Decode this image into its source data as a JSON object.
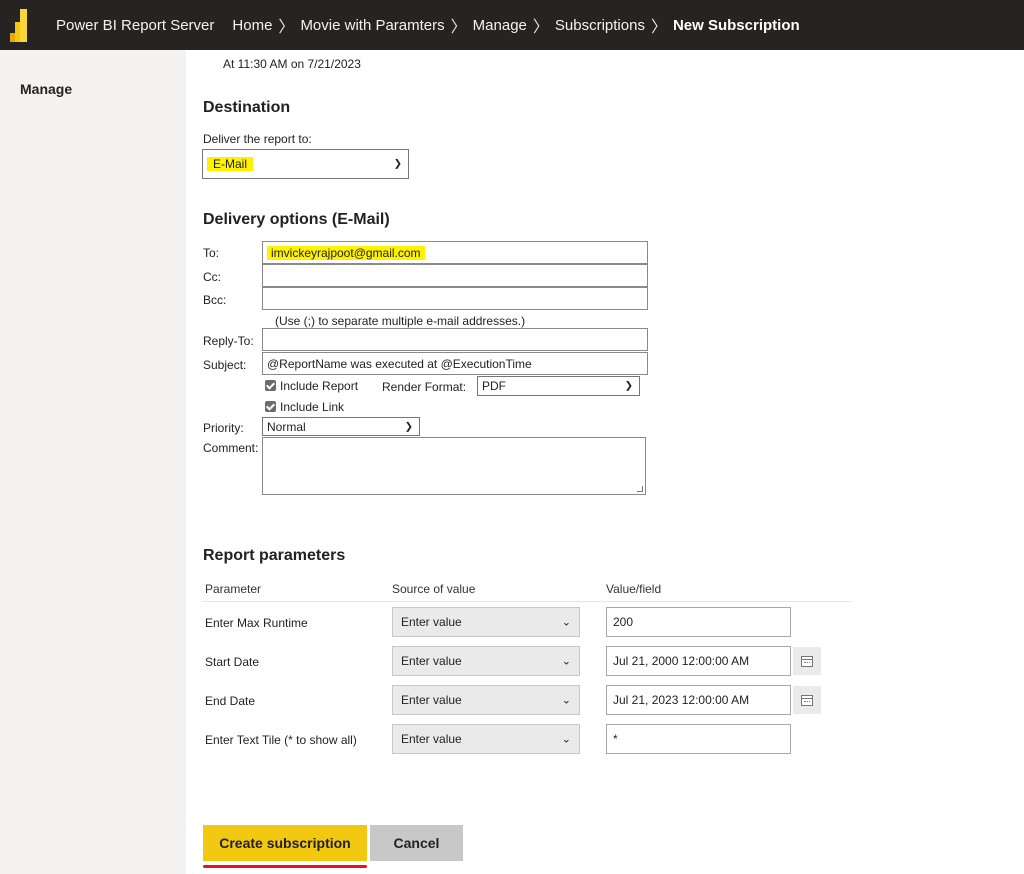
{
  "header": {
    "app_name": "Power BI Report Server",
    "breadcrumbs": [
      "Home",
      "Movie with Paramters",
      "Manage",
      "Subscriptions"
    ],
    "current": "New Subscription"
  },
  "sidebar": {
    "title": "Manage"
  },
  "schedule_text": "At 11:30 AM on 7/21/2023",
  "destination": {
    "heading": "Destination",
    "label": "Deliver the report to:",
    "value": "E-Mail"
  },
  "delivery": {
    "heading": "Delivery options (E-Mail)",
    "to_label": "To:",
    "to_value": "imvickeyrajpoot@gmail.com",
    "cc_label": "Cc:",
    "cc_value": "",
    "bcc_label": "Bcc:",
    "bcc_value": "",
    "hint": "(Use (;) to separate multiple e-mail addresses.)",
    "replyto_label": "Reply-To:",
    "replyto_value": "",
    "subject_label": "Subject:",
    "subject_value": "@ReportName was executed at @ExecutionTime",
    "include_report": "Include Report",
    "render_label": "Render Format:",
    "render_value": "PDF",
    "include_link": "Include Link",
    "priority_label": "Priority:",
    "priority_value": "Normal",
    "comment_label": "Comment:"
  },
  "parameters": {
    "heading": "Report parameters",
    "columns": [
      "Parameter",
      "Source of value",
      "Value/field"
    ],
    "rows": [
      {
        "name": "Enter Max Runtime",
        "source": "Enter value",
        "value": "200"
      },
      {
        "name": "Start Date",
        "source": "Enter value",
        "value": "Jul 21, 2000 12:00:00 AM"
      },
      {
        "name": "End Date",
        "source": "Enter value",
        "value": "Jul 21, 2023 12:00:00 AM"
      },
      {
        "name": "Enter Text Tile (* to show all)",
        "source": "Enter value",
        "value": "*"
      }
    ]
  },
  "buttons": {
    "create": "Create subscription",
    "cancel": "Cancel"
  },
  "colors": {
    "topbar": "#252423",
    "accent": "#f2c811",
    "highlight": "#fff200",
    "underline": "#e81123"
  }
}
